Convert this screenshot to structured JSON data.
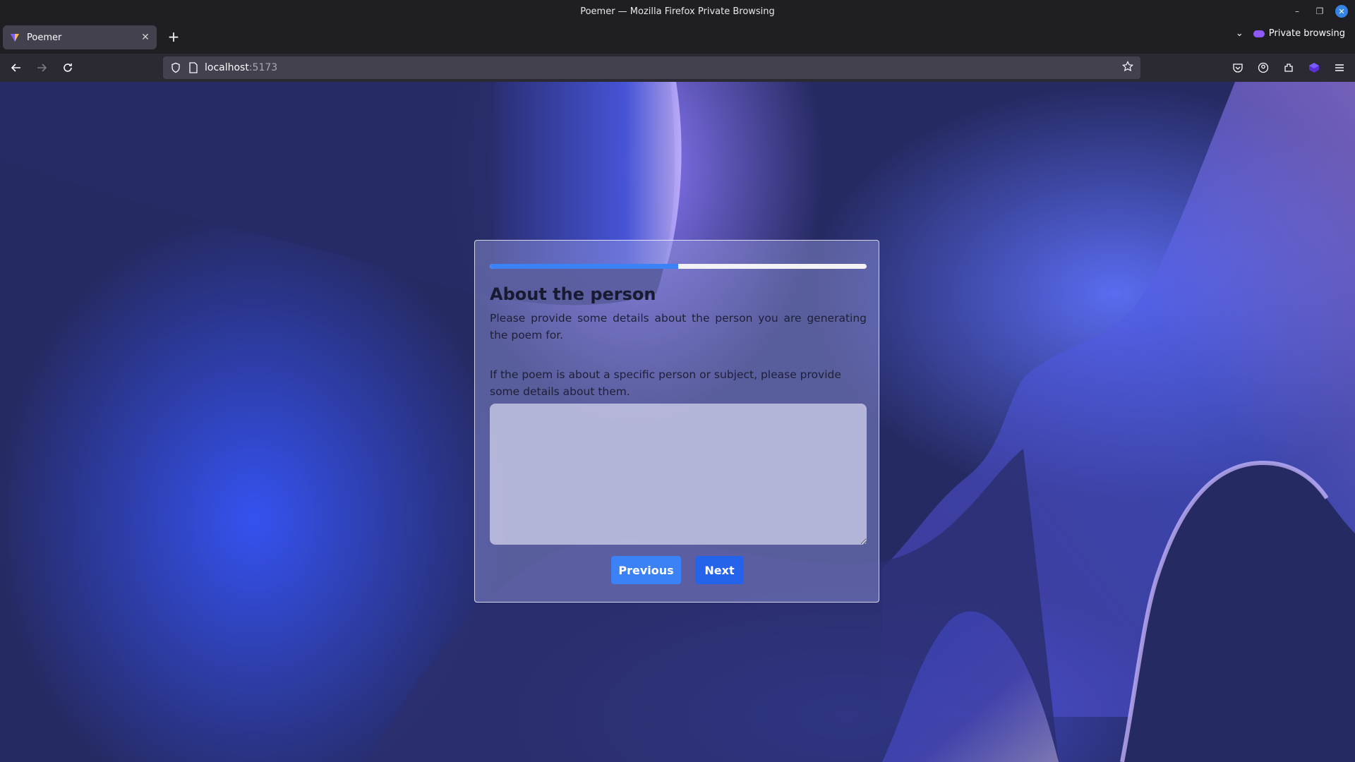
{
  "window": {
    "title": "Poemer — Mozilla Firefox Private Browsing"
  },
  "tab": {
    "title": "Poemer"
  },
  "toolbar": {
    "private_label": "Private browsing"
  },
  "urlbar": {
    "host": "localhost",
    "port": ":5173"
  },
  "form": {
    "progress": 0.5,
    "title": "About the person",
    "description": "Please provide some details about the person you are generating the poem for.",
    "field_label": "If the poem is about a specific person or subject, please provide some details about them.",
    "textarea_value": "",
    "previous_label": "Previous",
    "next_label": "Next"
  },
  "colors": {
    "accent": "#3b82f6",
    "next_button": "#2563eb"
  }
}
